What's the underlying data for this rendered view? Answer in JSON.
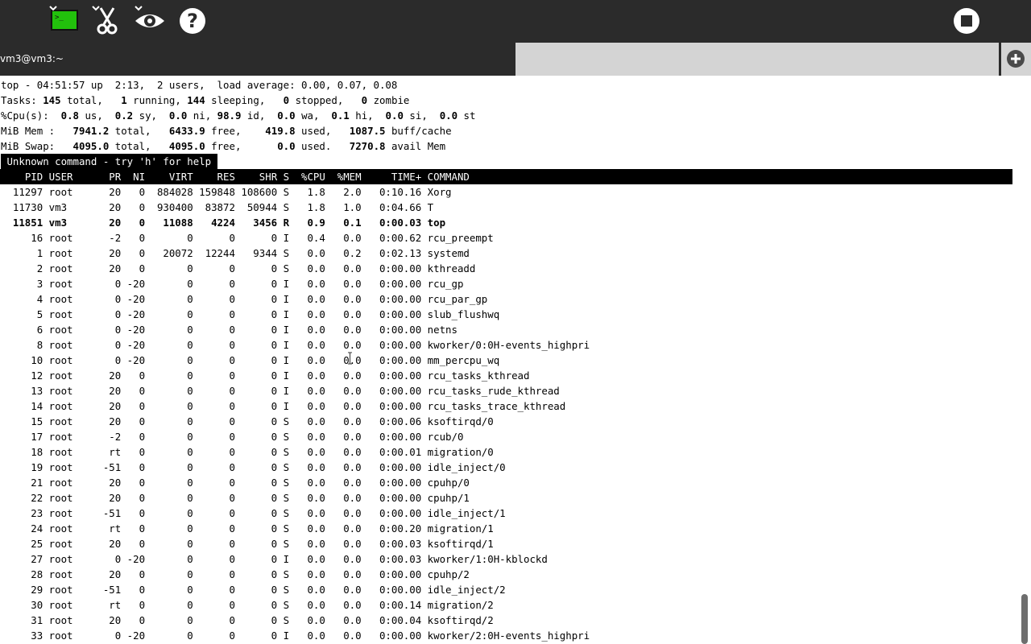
{
  "toolbar": {
    "terminal_icon": "terminal-icon",
    "scissors_icon": "scissors-icon",
    "eye_icon": "eye-icon",
    "help_icon": "help-icon",
    "stop_icon": "stop-icon",
    "terminal_color": "#22c10c"
  },
  "tab": {
    "title": "vm3@vm3:~",
    "new_tab_icon": "plus-icon"
  },
  "summary": {
    "top": "top - 04:51:57 up  2:13,  2 users,  load average: 0.00, 0.07, 0.08",
    "tasks": {
      "a": "Tasks: ",
      "total": "145",
      "b": " total,   ",
      "running": "1",
      "c": " running, ",
      "sleeping": "144",
      "d": " sleeping,   ",
      "stopped": "0",
      "e": " stopped,   ",
      "zombie": "0",
      "f": " zombie"
    },
    "cpu": {
      "a": "%Cpu(s):  ",
      "us": "0.8",
      "b": " us,  ",
      "sy": "0.2",
      "c": " sy,  ",
      "ni": "0.0",
      "d": " ni, ",
      "id": "98.9",
      "e": " id,  ",
      "wa": "0.0",
      "f": " wa,  ",
      "hi": "0.1",
      "g": " hi,  ",
      "si": "0.0",
      "h": " si,  ",
      "st": "0.0",
      "i": " st"
    },
    "mem": {
      "a": "MiB Mem :   ",
      "total": "7941.2",
      "b": " total,   ",
      "free": "6433.9",
      "c": " free,    ",
      "used": "419.8",
      "d": " used,   ",
      "cache": "1087.5",
      "e": " buff/cache"
    },
    "swap": {
      "a": "MiB Swap:   ",
      "total": "4095.0",
      "b": " total,   ",
      "free": "4095.0",
      "c": " free,      ",
      "used": "0.0",
      "d": " used.   ",
      "avail": "7270.8",
      "e": " avail Mem"
    },
    "message": " Unknown command - try 'h' for help "
  },
  "table": {
    "header": "    PID USER      PR  NI    VIRT    RES    SHR S  %CPU  %MEM     TIME+ COMMAND",
    "rows": [
      {
        "pid": "11297",
        "user": "root",
        "pr": "20",
        "ni": "0",
        "virt": "884028",
        "res": "159848",
        "shr": "108600",
        "s": "S",
        "cpu": "1.8",
        "mem": "2.0",
        "time": "0:10.16",
        "cmd": "Xorg"
      },
      {
        "pid": "11730",
        "user": "vm3",
        "pr": "20",
        "ni": "0",
        "virt": "930400",
        "res": "83872",
        "shr": "50944",
        "s": "S",
        "cpu": "1.8",
        "mem": "1.0",
        "time": "0:04.66",
        "cmd": "T"
      },
      {
        "pid": "11851",
        "user": "vm3",
        "pr": "20",
        "ni": "0",
        "virt": "11088",
        "res": "4224",
        "shr": "3456",
        "s": "R",
        "cpu": "0.9",
        "mem": "0.1",
        "time": "0:00.03",
        "cmd": "top",
        "bold": true
      },
      {
        "pid": "16",
        "user": "root",
        "pr": "-2",
        "ni": "0",
        "virt": "0",
        "res": "0",
        "shr": "0",
        "s": "I",
        "cpu": "0.4",
        "mem": "0.0",
        "time": "0:00.62",
        "cmd": "rcu_preempt"
      },
      {
        "pid": "1",
        "user": "root",
        "pr": "20",
        "ni": "0",
        "virt": "20072",
        "res": "12244",
        "shr": "9344",
        "s": "S",
        "cpu": "0.0",
        "mem": "0.2",
        "time": "0:02.13",
        "cmd": "systemd"
      },
      {
        "pid": "2",
        "user": "root",
        "pr": "20",
        "ni": "0",
        "virt": "0",
        "res": "0",
        "shr": "0",
        "s": "S",
        "cpu": "0.0",
        "mem": "0.0",
        "time": "0:00.00",
        "cmd": "kthreadd"
      },
      {
        "pid": "3",
        "user": "root",
        "pr": "0",
        "ni": "-20",
        "virt": "0",
        "res": "0",
        "shr": "0",
        "s": "I",
        "cpu": "0.0",
        "mem": "0.0",
        "time": "0:00.00",
        "cmd": "rcu_gp"
      },
      {
        "pid": "4",
        "user": "root",
        "pr": "0",
        "ni": "-20",
        "virt": "0",
        "res": "0",
        "shr": "0",
        "s": "I",
        "cpu": "0.0",
        "mem": "0.0",
        "time": "0:00.00",
        "cmd": "rcu_par_gp"
      },
      {
        "pid": "5",
        "user": "root",
        "pr": "0",
        "ni": "-20",
        "virt": "0",
        "res": "0",
        "shr": "0",
        "s": "I",
        "cpu": "0.0",
        "mem": "0.0",
        "time": "0:00.00",
        "cmd": "slub_flushwq"
      },
      {
        "pid": "6",
        "user": "root",
        "pr": "0",
        "ni": "-20",
        "virt": "0",
        "res": "0",
        "shr": "0",
        "s": "I",
        "cpu": "0.0",
        "mem": "0.0",
        "time": "0:00.00",
        "cmd": "netns"
      },
      {
        "pid": "8",
        "user": "root",
        "pr": "0",
        "ni": "-20",
        "virt": "0",
        "res": "0",
        "shr": "0",
        "s": "I",
        "cpu": "0.0",
        "mem": "0.0",
        "time": "0:00.00",
        "cmd": "kworker/0:0H-events_highpri"
      },
      {
        "pid": "10",
        "user": "root",
        "pr": "0",
        "ni": "-20",
        "virt": "0",
        "res": "0",
        "shr": "0",
        "s": "I",
        "cpu": "0.0",
        "mem": "0.0",
        "time": "0:00.00",
        "cmd": "mm_percpu_wq"
      },
      {
        "pid": "12",
        "user": "root",
        "pr": "20",
        "ni": "0",
        "virt": "0",
        "res": "0",
        "shr": "0",
        "s": "I",
        "cpu": "0.0",
        "mem": "0.0",
        "time": "0:00.00",
        "cmd": "rcu_tasks_kthread"
      },
      {
        "pid": "13",
        "user": "root",
        "pr": "20",
        "ni": "0",
        "virt": "0",
        "res": "0",
        "shr": "0",
        "s": "I",
        "cpu": "0.0",
        "mem": "0.0",
        "time": "0:00.00",
        "cmd": "rcu_tasks_rude_kthread"
      },
      {
        "pid": "14",
        "user": "root",
        "pr": "20",
        "ni": "0",
        "virt": "0",
        "res": "0",
        "shr": "0",
        "s": "I",
        "cpu": "0.0",
        "mem": "0.0",
        "time": "0:00.00",
        "cmd": "rcu_tasks_trace_kthread"
      },
      {
        "pid": "15",
        "user": "root",
        "pr": "20",
        "ni": "0",
        "virt": "0",
        "res": "0",
        "shr": "0",
        "s": "S",
        "cpu": "0.0",
        "mem": "0.0",
        "time": "0:00.06",
        "cmd": "ksoftirqd/0"
      },
      {
        "pid": "17",
        "user": "root",
        "pr": "-2",
        "ni": "0",
        "virt": "0",
        "res": "0",
        "shr": "0",
        "s": "S",
        "cpu": "0.0",
        "mem": "0.0",
        "time": "0:00.00",
        "cmd": "rcub/0"
      },
      {
        "pid": "18",
        "user": "root",
        "pr": "rt",
        "ni": "0",
        "virt": "0",
        "res": "0",
        "shr": "0",
        "s": "S",
        "cpu": "0.0",
        "mem": "0.0",
        "time": "0:00.01",
        "cmd": "migration/0"
      },
      {
        "pid": "19",
        "user": "root",
        "pr": "-51",
        "ni": "0",
        "virt": "0",
        "res": "0",
        "shr": "0",
        "s": "S",
        "cpu": "0.0",
        "mem": "0.0",
        "time": "0:00.00",
        "cmd": "idle_inject/0"
      },
      {
        "pid": "21",
        "user": "root",
        "pr": "20",
        "ni": "0",
        "virt": "0",
        "res": "0",
        "shr": "0",
        "s": "S",
        "cpu": "0.0",
        "mem": "0.0",
        "time": "0:00.00",
        "cmd": "cpuhp/0"
      },
      {
        "pid": "22",
        "user": "root",
        "pr": "20",
        "ni": "0",
        "virt": "0",
        "res": "0",
        "shr": "0",
        "s": "S",
        "cpu": "0.0",
        "mem": "0.0",
        "time": "0:00.00",
        "cmd": "cpuhp/1"
      },
      {
        "pid": "23",
        "user": "root",
        "pr": "-51",
        "ni": "0",
        "virt": "0",
        "res": "0",
        "shr": "0",
        "s": "S",
        "cpu": "0.0",
        "mem": "0.0",
        "time": "0:00.00",
        "cmd": "idle_inject/1"
      },
      {
        "pid": "24",
        "user": "root",
        "pr": "rt",
        "ni": "0",
        "virt": "0",
        "res": "0",
        "shr": "0",
        "s": "S",
        "cpu": "0.0",
        "mem": "0.0",
        "time": "0:00.20",
        "cmd": "migration/1"
      },
      {
        "pid": "25",
        "user": "root",
        "pr": "20",
        "ni": "0",
        "virt": "0",
        "res": "0",
        "shr": "0",
        "s": "S",
        "cpu": "0.0",
        "mem": "0.0",
        "time": "0:00.03",
        "cmd": "ksoftirqd/1"
      },
      {
        "pid": "27",
        "user": "root",
        "pr": "0",
        "ni": "-20",
        "virt": "0",
        "res": "0",
        "shr": "0",
        "s": "I",
        "cpu": "0.0",
        "mem": "0.0",
        "time": "0:00.03",
        "cmd": "kworker/1:0H-kblockd"
      },
      {
        "pid": "28",
        "user": "root",
        "pr": "20",
        "ni": "0",
        "virt": "0",
        "res": "0",
        "shr": "0",
        "s": "S",
        "cpu": "0.0",
        "mem": "0.0",
        "time": "0:00.00",
        "cmd": "cpuhp/2"
      },
      {
        "pid": "29",
        "user": "root",
        "pr": "-51",
        "ni": "0",
        "virt": "0",
        "res": "0",
        "shr": "0",
        "s": "S",
        "cpu": "0.0",
        "mem": "0.0",
        "time": "0:00.00",
        "cmd": "idle_inject/2"
      },
      {
        "pid": "30",
        "user": "root",
        "pr": "rt",
        "ni": "0",
        "virt": "0",
        "res": "0",
        "shr": "0",
        "s": "S",
        "cpu": "0.0",
        "mem": "0.0",
        "time": "0:00.14",
        "cmd": "migration/2"
      },
      {
        "pid": "31",
        "user": "root",
        "pr": "20",
        "ni": "0",
        "virt": "0",
        "res": "0",
        "shr": "0",
        "s": "S",
        "cpu": "0.0",
        "mem": "0.0",
        "time": "0:00.04",
        "cmd": "ksoftirqd/2"
      },
      {
        "pid": "33",
        "user": "root",
        "pr": "0",
        "ni": "-20",
        "virt": "0",
        "res": "0",
        "shr": "0",
        "s": "I",
        "cpu": "0.0",
        "mem": "0.0",
        "time": "0:00.00",
        "cmd": "kworker/2:0H-events_highpri"
      }
    ]
  }
}
